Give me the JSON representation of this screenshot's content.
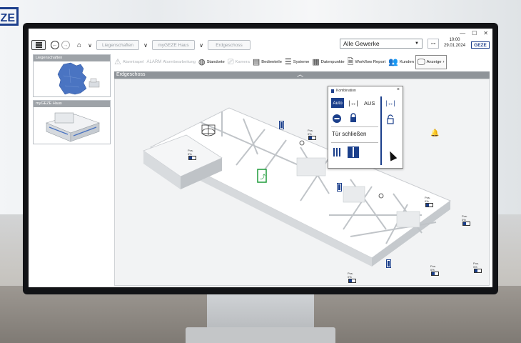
{
  "brand": {
    "corner_logo": "ZE",
    "accent": "#1b3f8b"
  },
  "toolbar": {
    "menu_icon": "hamburger-icon",
    "back_icon": "back-icon",
    "forward_icon": "forward-icon",
    "home_icon": "home-icon",
    "breadcrumbs": [
      {
        "label": "Liegenschaften"
      },
      {
        "label": "myGEZE Haus"
      },
      {
        "label": "Erdgeschoss"
      }
    ],
    "trade_select": "Alle Gewerke",
    "time": "10:00",
    "date": "29.01.2024",
    "logo": "GEZE"
  },
  "sidebar": {
    "panels": [
      {
        "title": "Liegenschaften",
        "image": "germany-map"
      },
      {
        "title": "myGEZE Haus",
        "image": "building-3d"
      }
    ]
  },
  "tabs": [
    {
      "label": "Alarmtrapel",
      "icon": "warning-icon",
      "active": false
    },
    {
      "label": "Alarmbearbeitung",
      "icon": "alarm-icon",
      "active": false
    },
    {
      "label": "Standorte",
      "icon": "globe-icon",
      "active": true
    },
    {
      "label": "Kamera",
      "icon": "camera-icon",
      "active": false
    },
    {
      "label": "Bedienteile",
      "icon": "panel-icon",
      "active": true
    },
    {
      "label": "Systeme",
      "icon": "server-icon",
      "active": true
    },
    {
      "label": "Datenpunkte",
      "icon": "datapoints-icon",
      "active": true
    },
    {
      "label": "Workflow Report",
      "icon": "report-icon",
      "active": true
    },
    {
      "label": "Kunden",
      "icon": "people-icon",
      "active": true
    },
    {
      "label": "Anzeige",
      "icon": "monitor-icon",
      "active": true,
      "selected": true
    }
  ],
  "floor": {
    "title": "Erdgeschoss"
  },
  "popup": {
    "title": "Kombination",
    "auto": "Auto",
    "aus": "AUS",
    "door_status": "Tür schließen"
  },
  "markers": [
    {
      "label": "Pos.",
      "value": "0%"
    },
    {
      "label": "Pos.",
      "value": "0%"
    },
    {
      "label": "Pos.",
      "value": "0%"
    },
    {
      "label": "Pos.",
      "value": "0%"
    },
    {
      "label": "Pos.",
      "value": "0%"
    },
    {
      "label": "Pos.",
      "value": "0%"
    },
    {
      "label": "Pos.",
      "value": "0%"
    },
    {
      "label": "Pos.",
      "value": "0%"
    }
  ]
}
